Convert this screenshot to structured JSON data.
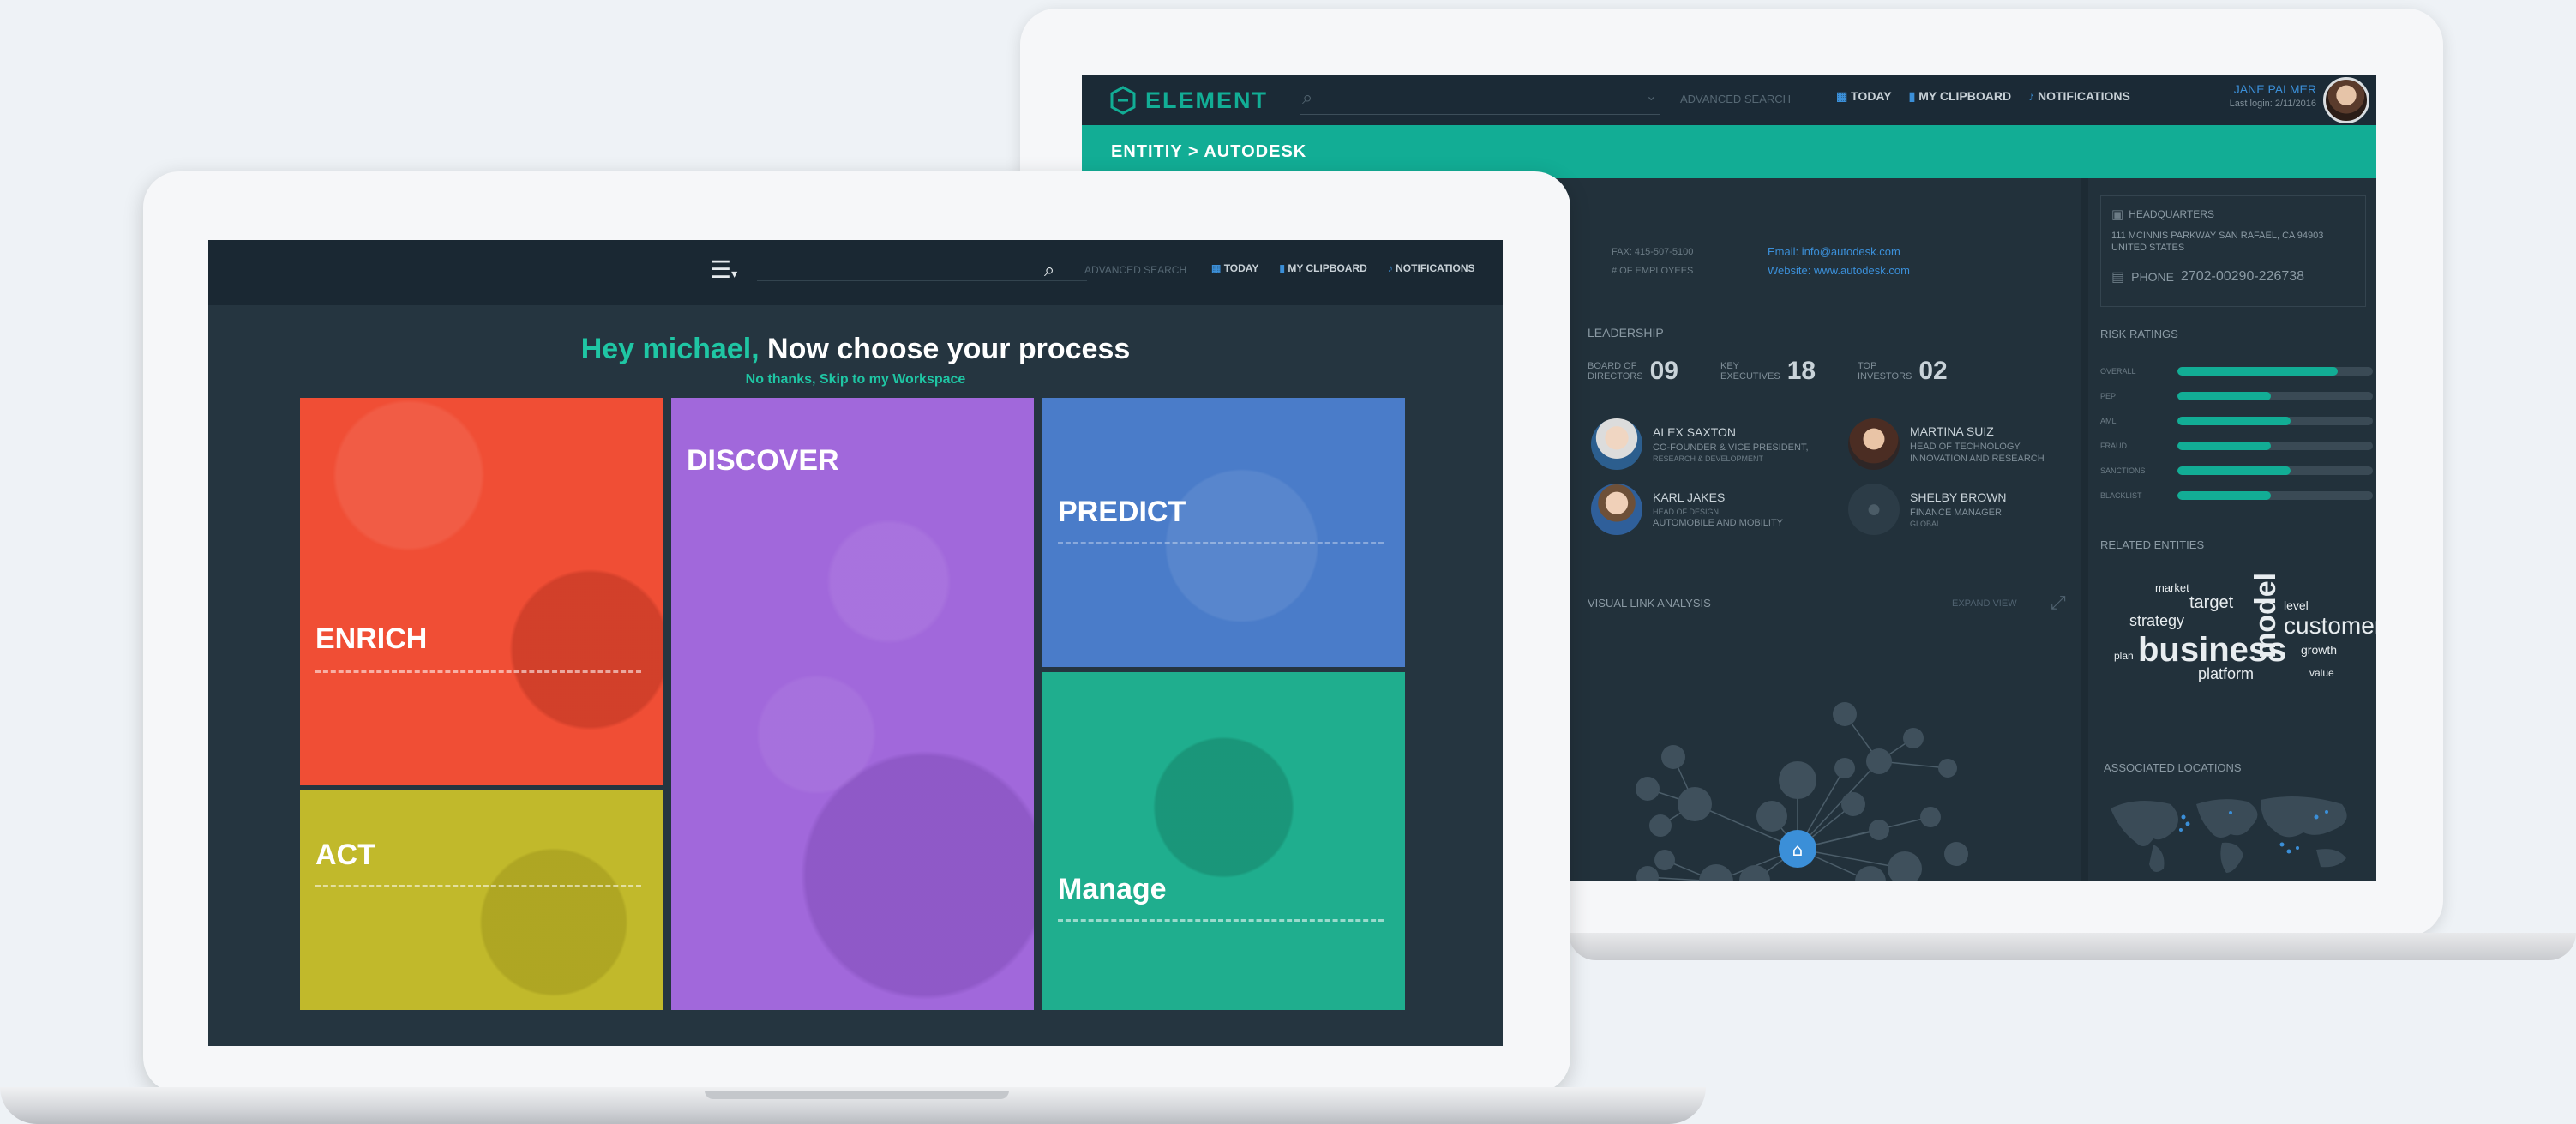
{
  "back": {
    "brand": "ELEMENT",
    "search": {
      "placeholder": "",
      "advanced_label": "ADVANCED SEARCH"
    },
    "nav": [
      {
        "label": "TODAY",
        "icon": "calendar-icon"
      },
      {
        "label": "MY CLIPBOARD",
        "icon": "bookmark-icon"
      },
      {
        "label": "NOTIFICATIONS",
        "icon": "bell-icon"
      }
    ],
    "user": {
      "name": "JANE PALMER",
      "last_login": "Last login: 2/11/2016"
    },
    "breadcrumb": "ENTITIY > AUTODESK",
    "contact": {
      "fax_label": "FAX: 415-507-5100",
      "other_label": "# OF EMPLOYEES",
      "email": "Email: info@autodesk.com",
      "website": "Website: www.autodesk.com"
    },
    "hq": {
      "title": "HEADQUARTERS",
      "address_line1": "111 MCINNIS PARKWAY SAN RAFAEL, CA 94903",
      "address_line2": "UNITED STATES",
      "phone_label": "PHONE",
      "phone_value": "2702-00290-226738"
    },
    "leadership": {
      "title": "LEADERSHIP",
      "stats": [
        {
          "label_line1": "BOARD OF",
          "label_line2": "DIRECTORS",
          "value": "09"
        },
        {
          "label_line1": "KEY",
          "label_line2": "EXECUTIVES",
          "value": "18"
        },
        {
          "label_line1": "TOP",
          "label_line2": "INVESTORS",
          "value": "02"
        }
      ],
      "people": [
        {
          "name": "ALEX SAXTON",
          "role_line1": "CO-FOUNDER & VICE PRESIDENT,",
          "role_line2": "RESEARCH & DEVELOPMENT"
        },
        {
          "name": "MARTINA SUIZ",
          "role_line1": "HEAD OF TECHNOLOGY",
          "role_line2": "INNOVATION AND RESEARCH"
        },
        {
          "name": "KARL JAKES",
          "role_line1": "HEAD OF DESIGN",
          "role_line2": "AUTOMOBILE AND MOBILITY"
        },
        {
          "name": "SHELBY BROWN",
          "role_line1": "FINANCE MANAGER",
          "role_line2": "GLOBAL"
        }
      ]
    },
    "risk": {
      "title": "RISK RATINGS",
      "items": [
        {
          "label": "OVERALL",
          "value": 0.82
        },
        {
          "label": "PEP",
          "value": 0.48
        },
        {
          "label": "AML",
          "value": 0.58
        },
        {
          "label": "FRAUD",
          "value": 0.48
        },
        {
          "label": "SANCTIONS",
          "value": 0.58
        },
        {
          "label": "BLACKLIST",
          "value": 0.48
        }
      ]
    },
    "related": {
      "title": "RELATED ENTITIES",
      "words": [
        "business",
        "model",
        "customer",
        "strategy",
        "target",
        "platform",
        "level",
        "plan",
        "market",
        "value",
        "growth"
      ]
    },
    "link_analysis": {
      "title": "VISUAL LINK ANALYSIS",
      "expand_label": "EXPAND VIEW"
    },
    "locations": {
      "title": "ASSOCIATED LOCATIONS"
    },
    "colors": {
      "teal": "#12ad95",
      "dark": "#22313b",
      "topbar": "#1b2a36",
      "accent_blue": "#3b8fd8"
    }
  },
  "front": {
    "topbar": {
      "menu_icon": "hamburger-menu-icon",
      "advanced_label": "ADVANCED SEARCH",
      "nav": [
        {
          "label": "TODAY",
          "icon": "calendar-icon"
        },
        {
          "label": "MY CLIPBOARD",
          "icon": "bookmark-icon"
        },
        {
          "label": "NOTIFICATIONS",
          "icon": "bell-icon"
        }
      ]
    },
    "greeting": {
      "hello": "Hey michael,",
      "prompt": "Now choose your process",
      "skip": "No thanks, Skip to my Workspace"
    },
    "tiles": [
      {
        "id": "enrich",
        "label": "ENRICH",
        "color": "#f04e35"
      },
      {
        "id": "discover",
        "label": "DISCOVER",
        "color": "#a168db"
      },
      {
        "id": "predict",
        "label": "PREDICT",
        "color": "#4a7cc9"
      },
      {
        "id": "act",
        "label": "ACT",
        "color": "#c1b92b"
      },
      {
        "id": "manage",
        "label": "Manage",
        "color": "#1fae8e"
      }
    ]
  }
}
